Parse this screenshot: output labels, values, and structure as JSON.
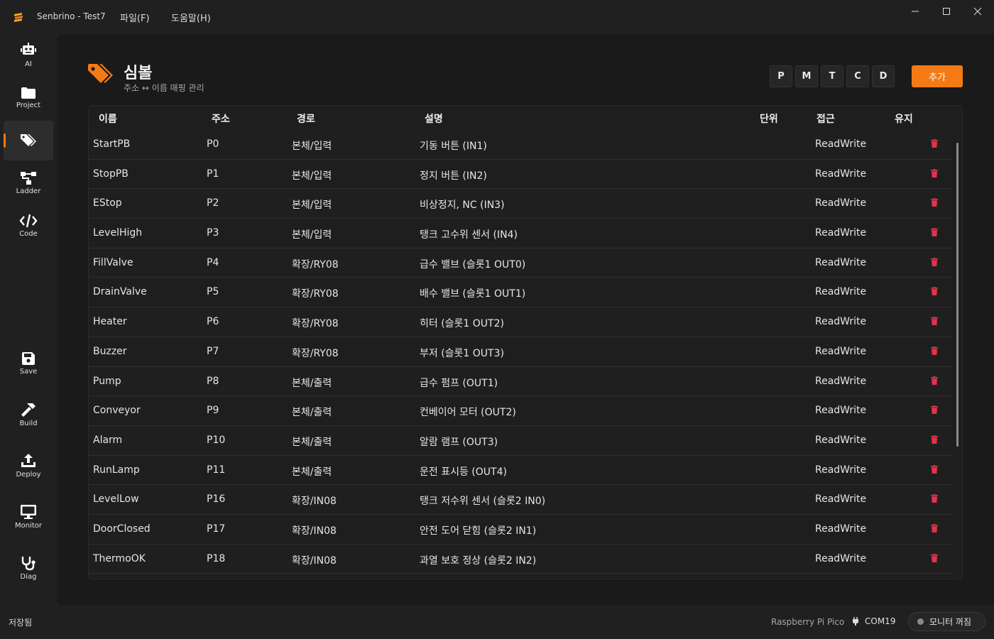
{
  "app": {
    "title": "Senbrino - Test7",
    "menu": {
      "file": "파일(F)",
      "help": "도움말(H)"
    }
  },
  "sidebar": {
    "items": [
      {
        "label": "AI",
        "icon": "robot-icon"
      },
      {
        "label": "Project",
        "icon": "folder-icon"
      },
      {
        "label": "",
        "icon": "tag-icon",
        "active": true
      },
      {
        "label": "Ladder",
        "icon": "ladder-icon"
      },
      {
        "label": "Code",
        "icon": "code-icon"
      },
      {
        "label": "Save",
        "icon": "save-icon"
      },
      {
        "label": "Build",
        "icon": "hammer-icon"
      },
      {
        "label": "Deploy",
        "icon": "upload-icon"
      },
      {
        "label": "Monitor",
        "icon": "monitor-icon"
      },
      {
        "label": "Diag",
        "icon": "stethoscope-icon"
      }
    ]
  },
  "page": {
    "title": "심볼",
    "subtitle": "주소 ↔ 이름 매핑 관리",
    "filters": [
      "P",
      "M",
      "T",
      "C",
      "D"
    ],
    "add_label": "추가"
  },
  "table": {
    "headers": {
      "name": "이름",
      "address": "주소",
      "path": "경로",
      "description": "설명",
      "unit": "단위",
      "access": "접근",
      "retain": "유지"
    },
    "rows": [
      {
        "name": "StartPB",
        "address": "P0",
        "path": "본체/입력",
        "description": "기동 버튼 (IN1)",
        "access": "ReadWrite"
      },
      {
        "name": "StopPB",
        "address": "P1",
        "path": "본체/입력",
        "description": "정지 버튼 (IN2)",
        "access": "ReadWrite"
      },
      {
        "name": "EStop",
        "address": "P2",
        "path": "본체/입력",
        "description": "비상정지, NC (IN3)",
        "access": "ReadWrite"
      },
      {
        "name": "LevelHigh",
        "address": "P3",
        "path": "본체/입력",
        "description": "탱크 고수위 센서 (IN4)",
        "access": "ReadWrite"
      },
      {
        "name": "FillValve",
        "address": "P4",
        "path": "확장/RY08",
        "description": "급수 밸브 (슬롯1 OUT0)",
        "access": "ReadWrite"
      },
      {
        "name": "DrainValve",
        "address": "P5",
        "path": "확장/RY08",
        "description": "배수 밸브 (슬롯1 OUT1)",
        "access": "ReadWrite"
      },
      {
        "name": "Heater",
        "address": "P6",
        "path": "확장/RY08",
        "description": "히터 (슬롯1 OUT2)",
        "access": "ReadWrite"
      },
      {
        "name": "Buzzer",
        "address": "P7",
        "path": "확장/RY08",
        "description": "부저 (슬롯1 OUT3)",
        "access": "ReadWrite"
      },
      {
        "name": "Pump",
        "address": "P8",
        "path": "본체/출력",
        "description": "급수 펌프 (OUT1)",
        "access": "ReadWrite"
      },
      {
        "name": "Conveyor",
        "address": "P9",
        "path": "본체/출력",
        "description": "컨베이어 모터 (OUT2)",
        "access": "ReadWrite"
      },
      {
        "name": "Alarm",
        "address": "P10",
        "path": "본체/출력",
        "description": "알람 램프 (OUT3)",
        "access": "ReadWrite"
      },
      {
        "name": "RunLamp",
        "address": "P11",
        "path": "본체/출력",
        "description": "운전 표시등 (OUT4)",
        "access": "ReadWrite"
      },
      {
        "name": "LevelLow",
        "address": "P16",
        "path": "확장/IN08",
        "description": "탱크 저수위 센서 (슬롯2 IN0)",
        "access": "ReadWrite"
      },
      {
        "name": "DoorClosed",
        "address": "P17",
        "path": "확장/IN08",
        "description": "안전 도어 닫힘 (슬롯2 IN1)",
        "access": "ReadWrite"
      },
      {
        "name": "ThermoOK",
        "address": "P18",
        "path": "확장/IN08",
        "description": "과열 보호 정상 (슬롯2 IN2)",
        "access": "ReadWrite"
      }
    ]
  },
  "status": {
    "saved": "저장됨",
    "device": "Raspberry Pi Pico",
    "port": "COM19",
    "monitor": "모니터 꺼짐"
  },
  "colors": {
    "accent": "#f47b14",
    "delete": "#e0344a"
  }
}
